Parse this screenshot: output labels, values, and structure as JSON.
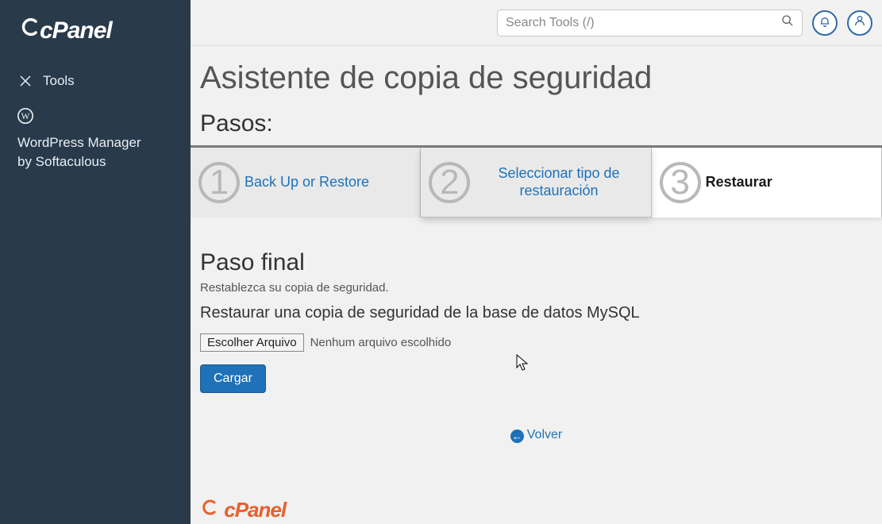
{
  "brand": {
    "name": "cPanel"
  },
  "sidebar": {
    "items": [
      {
        "label": "Tools"
      },
      {
        "label": "WordPress Manager by Softaculous"
      }
    ]
  },
  "topbar": {
    "search_placeholder": "Search Tools (/)"
  },
  "page": {
    "title": "Asistente de copia de seguridad",
    "steps_label": "Pasos:",
    "steps": [
      {
        "num": "1",
        "label": "Back Up or Restore"
      },
      {
        "num": "2",
        "label": "Seleccionar tipo de restauración"
      },
      {
        "num": "3",
        "label": "Restaurar"
      }
    ],
    "final": {
      "heading": "Paso final",
      "subtext": "Restablezca su copia de seguridad.",
      "subtitle": "Restaurar una copia de seguridad de la base de datos MySQL",
      "file_button": "Escolher Arquivo",
      "file_status": "Nenhum arquivo escolhido",
      "upload_button": "Cargar"
    },
    "back_link": "Volver"
  }
}
